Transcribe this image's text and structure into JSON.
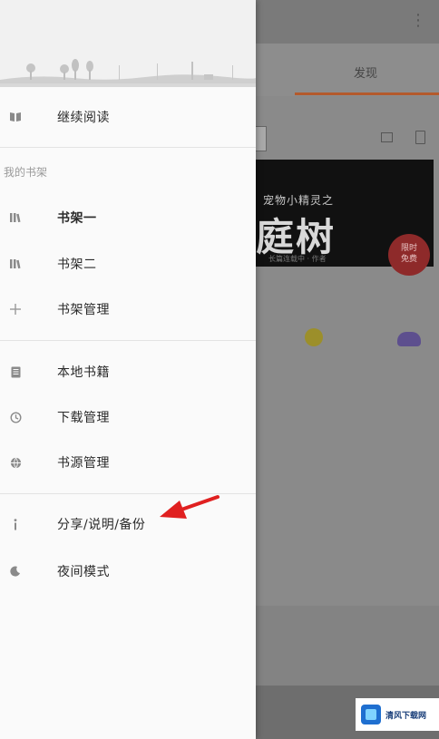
{
  "background_app": {
    "tab_label": "发现",
    "banner_subtitle": "宠物小精灵之",
    "banner_title": "庭树",
    "banner_footer": "长篇连载中 · 作者",
    "badge_text": "限时\n免费",
    "accent_color": "#b45a2c"
  },
  "drawer": {
    "continue_reading": {
      "icon": "open-book-icon",
      "label": "继续阅读"
    },
    "section_title": "我的书架",
    "shelves": [
      {
        "icon": "books-icon",
        "label": "书架一",
        "bold": true
      },
      {
        "icon": "books-icon",
        "label": "书架二",
        "bold": false
      },
      {
        "icon": "plus-icon",
        "label": "书架管理",
        "bold": false
      }
    ],
    "tools": [
      {
        "icon": "document-icon",
        "label": "本地书籍"
      },
      {
        "icon": "history-icon",
        "label": "下载管理"
      },
      {
        "icon": "globe-icon",
        "label": "书源管理"
      }
    ],
    "misc": [
      {
        "icon": "info-icon",
        "label": "分享/说明/备份"
      },
      {
        "icon": "moon-icon",
        "label": "夜间模式"
      }
    ]
  },
  "annotation": {
    "color": "#e02020"
  },
  "watermark": {
    "text": "清风下载网"
  }
}
